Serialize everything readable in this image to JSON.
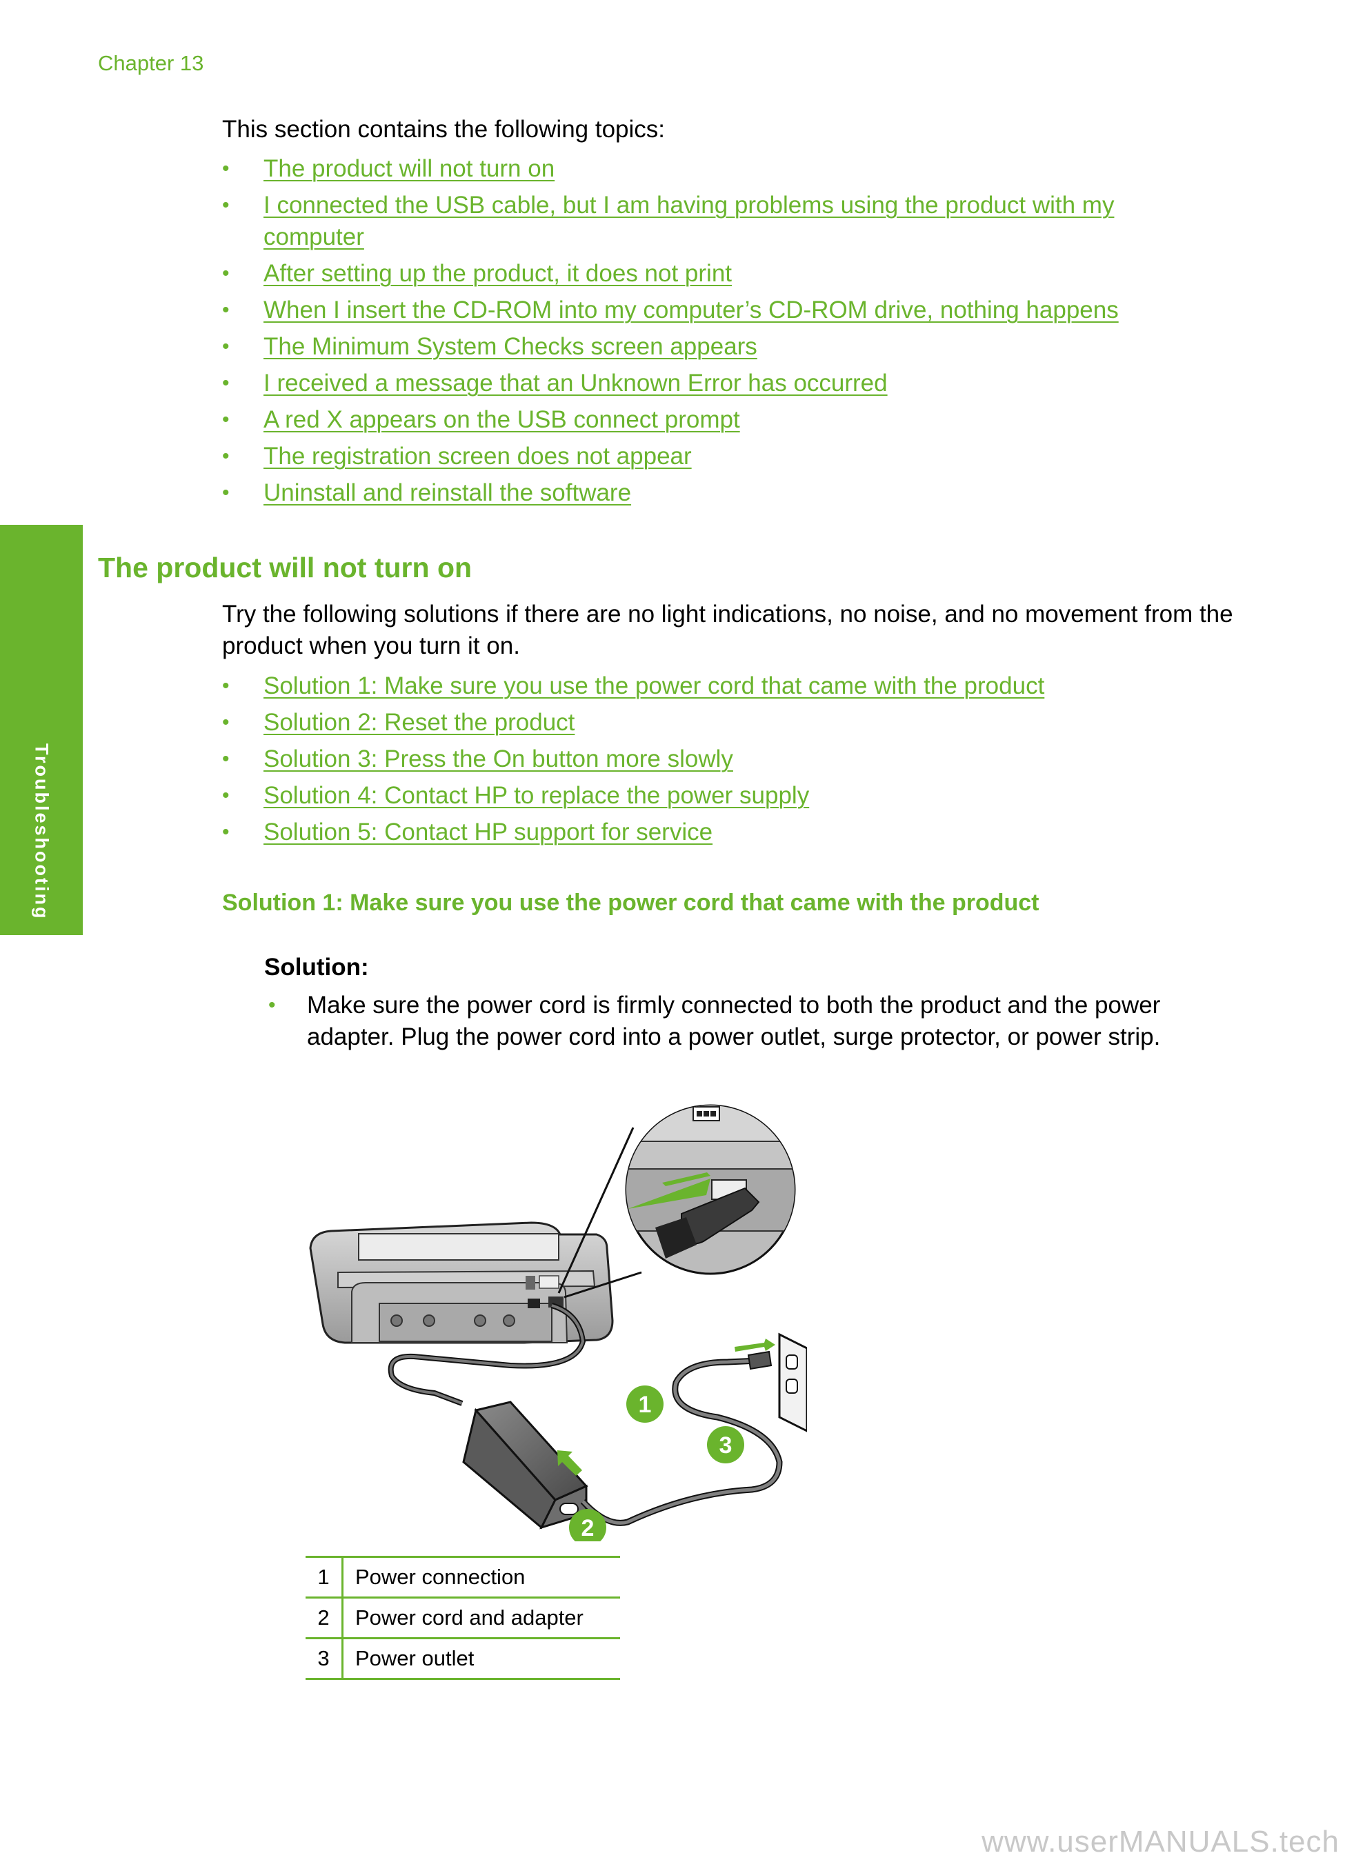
{
  "header": {
    "chapter": "Chapter 13"
  },
  "sidebar": {
    "label": "Troubleshooting"
  },
  "intro": "This section contains the following topics:",
  "topics": [
    "The product will not turn on",
    "I connected the USB cable, but I am having problems using the product with my computer",
    "After setting up the product, it does not print",
    "When I insert the CD-ROM into my computer’s CD-ROM drive, nothing happens",
    "The Minimum System Checks screen appears",
    "I received a message that an Unknown Error has occurred",
    "A red X appears on the USB connect prompt",
    "The registration screen does not appear",
    "Uninstall and reinstall the software"
  ],
  "section": {
    "title": "The product will not turn on",
    "description": "Try the following solutions if there are no light indications, no noise, and no movement from the product when you turn it on.",
    "solutions": [
      "Solution 1: Make sure you use the power cord that came with the product",
      "Solution 2: Reset the product",
      "Solution 3: Press the On button more slowly",
      "Solution 4: Contact HP to replace the power supply",
      "Solution 5: Contact HP support for service"
    ]
  },
  "solution1": {
    "title": "Solution 1: Make sure you use the power cord that came with the product",
    "label": "Solution:",
    "step": "Make sure the power cord is firmly connected to both the product and the power adapter. Plug the power cord into a power outlet, surge protector, or power strip."
  },
  "figure": {
    "callouts": [
      "1",
      "2",
      "3"
    ],
    "legend": [
      {
        "num": "1",
        "label": "Power connection"
      },
      {
        "num": "2",
        "label": "Power cord and adapter"
      },
      {
        "num": "3",
        "label": "Power outlet"
      }
    ]
  },
  "bullet_glyph": "•",
  "watermark": "www.userMANUALS.tech",
  "colors": {
    "accent": "#6AB42D",
    "text": "#000000",
    "watermark": "#C8C8C8"
  }
}
